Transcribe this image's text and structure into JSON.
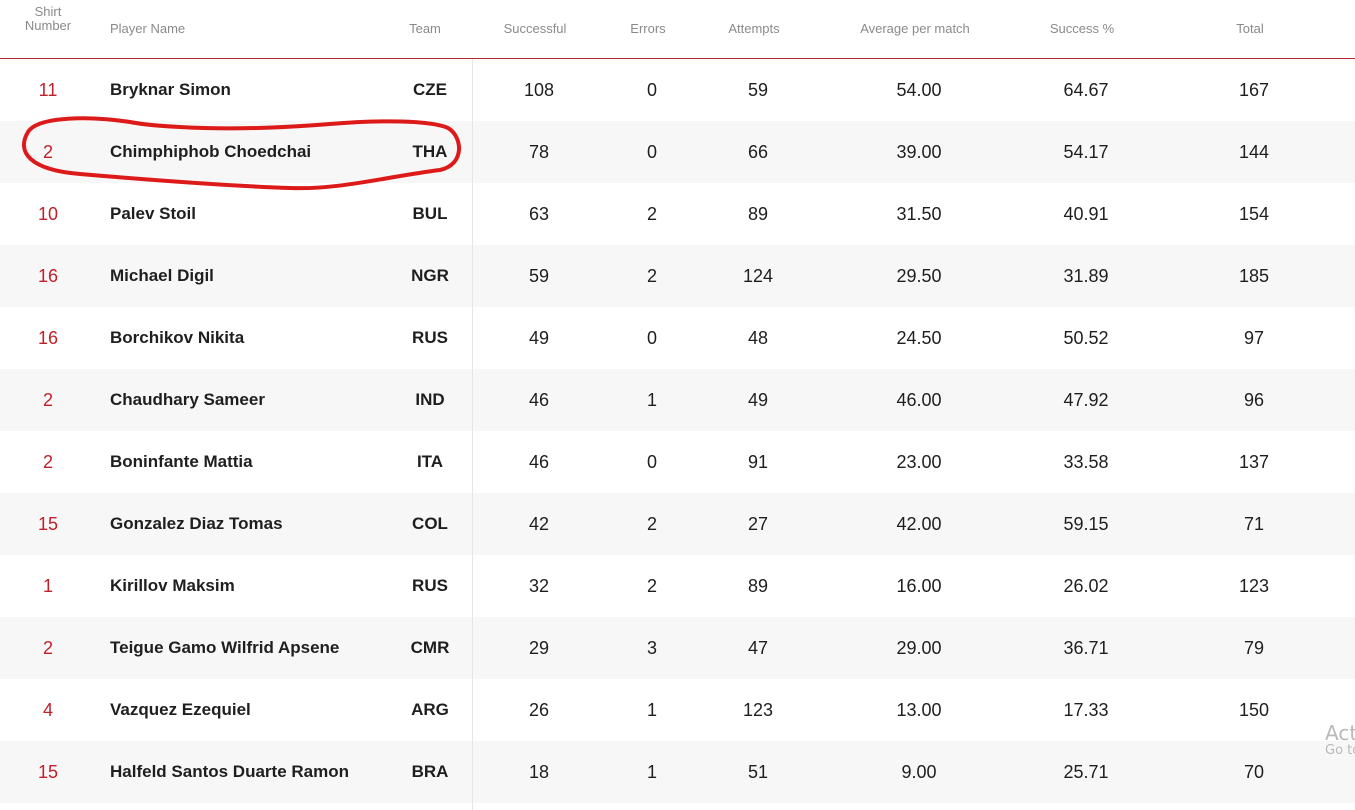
{
  "table": {
    "headers": {
      "shirt_number": "Shirt\nNumber",
      "player_name": "Player Name",
      "team": "Team",
      "successful": "Successful",
      "errors": "Errors",
      "attempts": "Attempts",
      "average_per_match": "Average per match",
      "success_pct": "Success %",
      "total": "Total"
    },
    "rows": [
      {
        "shirt": "11",
        "name": "Bryknar Simon",
        "team": "CZE",
        "successful": "108",
        "errors": "0",
        "attempts": "59",
        "average": "54.00",
        "pct": "64.67",
        "total": "167"
      },
      {
        "shirt": "2",
        "name": "Chimphiphob Choedchai",
        "team": "THA",
        "successful": "78",
        "errors": "0",
        "attempts": "66",
        "average": "39.00",
        "pct": "54.17",
        "total": "144"
      },
      {
        "shirt": "10",
        "name": "Palev Stoil",
        "team": "BUL",
        "successful": "63",
        "errors": "2",
        "attempts": "89",
        "average": "31.50",
        "pct": "40.91",
        "total": "154"
      },
      {
        "shirt": "16",
        "name": "Michael Digil",
        "team": "NGR",
        "successful": "59",
        "errors": "2",
        "attempts": "124",
        "average": "29.50",
        "pct": "31.89",
        "total": "185"
      },
      {
        "shirt": "16",
        "name": "Borchikov Nikita",
        "team": "RUS",
        "successful": "49",
        "errors": "0",
        "attempts": "48",
        "average": "24.50",
        "pct": "50.52",
        "total": "97"
      },
      {
        "shirt": "2",
        "name": "Chaudhary Sameer",
        "team": "IND",
        "successful": "46",
        "errors": "1",
        "attempts": "49",
        "average": "46.00",
        "pct": "47.92",
        "total": "96"
      },
      {
        "shirt": "2",
        "name": "Boninfante Mattia",
        "team": "ITA",
        "successful": "46",
        "errors": "0",
        "attempts": "91",
        "average": "23.00",
        "pct": "33.58",
        "total": "137"
      },
      {
        "shirt": "15",
        "name": "Gonzalez Diaz Tomas",
        "team": "COL",
        "successful": "42",
        "errors": "2",
        "attempts": "27",
        "average": "42.00",
        "pct": "59.15",
        "total": "71"
      },
      {
        "shirt": "1",
        "name": "Kirillov Maksim",
        "team": "RUS",
        "successful": "32",
        "errors": "2",
        "attempts": "89",
        "average": "16.00",
        "pct": "26.02",
        "total": "123"
      },
      {
        "shirt": "2",
        "name": "Teigue Gamo Wilfrid Apsene",
        "team": "CMR",
        "successful": "29",
        "errors": "3",
        "attempts": "47",
        "average": "29.00",
        "pct": "36.71",
        "total": "79"
      },
      {
        "shirt": "4",
        "name": "Vazquez Ezequiel",
        "team": "ARG",
        "successful": "26",
        "errors": "1",
        "attempts": "123",
        "average": "13.00",
        "pct": "17.33",
        "total": "150"
      },
      {
        "shirt": "15",
        "name": "Halfeld Santos Duarte Ramon",
        "team": "BRA",
        "successful": "18",
        "errors": "1",
        "attempts": "51",
        "average": "9.00",
        "pct": "25.71",
        "total": "70"
      }
    ]
  },
  "watermark": {
    "line1": "Act",
    "line2": "Go to"
  },
  "colors": {
    "accent": "#c0202a",
    "header_text": "#8a8a8a",
    "row_alt": "#f7f7f7",
    "annotation": "#dd1a1a"
  }
}
